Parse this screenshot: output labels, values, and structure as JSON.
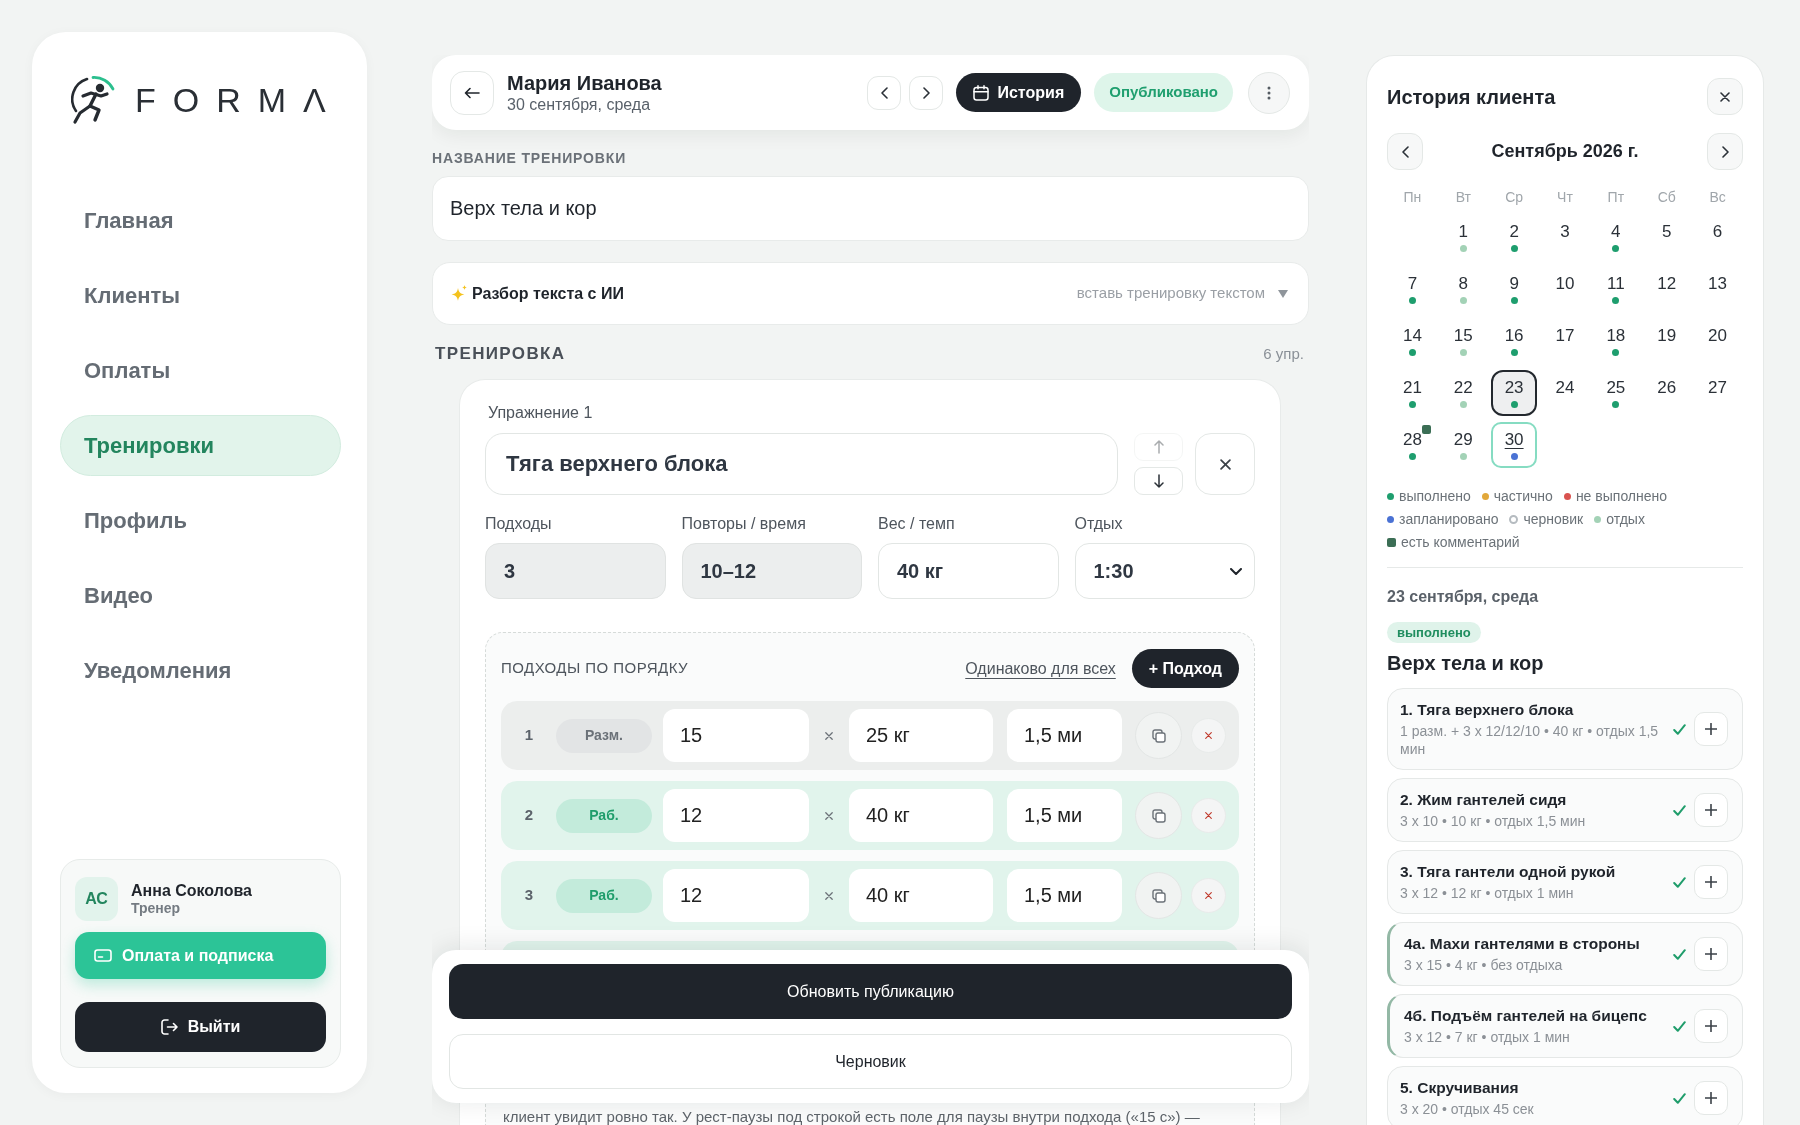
{
  "sidebar": {
    "logo": {
      "text": "FORMΛ"
    },
    "nav": [
      {
        "label": "Главная",
        "selected": false
      },
      {
        "label": "Клиенты",
        "selected": false
      },
      {
        "label": "Оплаты",
        "selected": false
      },
      {
        "label": "Тренировки",
        "selected": true
      },
      {
        "label": "Профиль",
        "selected": false
      },
      {
        "label": "Видео",
        "selected": false
      },
      {
        "label": "Уведомления",
        "selected": false
      }
    ],
    "user": {
      "initials": "АС",
      "name": "Анна Соколова",
      "role": "Тренер"
    },
    "buttons": [
      {
        "label": "Оплата и подписка",
        "kind": "payment"
      },
      {
        "label": "Выйти",
        "kind": "logout"
      }
    ]
  },
  "header": {
    "client_name": "Мария Иванова",
    "date": "30 сентября, среда",
    "history_button": "История",
    "status": "Опубликовано"
  },
  "workout_name": {
    "label": "НАЗВАНИЕ ТРЕНИРОВКИ",
    "value": "Верх тела и кор"
  },
  "ai_parser": {
    "title": "Разбор текста с ИИ",
    "hint": "вставь тренировку текстом",
    "expanded": false
  },
  "workout": {
    "title": "ТРЕНИРОВКА",
    "count": "6 упр.",
    "exercise": {
      "label": "Упражнение 1",
      "name": "Тяга верхнего блока",
      "move_buttons": [
        {
          "kind": "up",
          "disabled": true
        },
        {
          "kind": "down",
          "disabled": false
        }
      ],
      "fields": [
        {
          "label": "Подходы",
          "value": "3",
          "kind": "input",
          "disabled": true
        },
        {
          "label": "Повторы / время",
          "value": "10–12",
          "kind": "input",
          "disabled": true
        },
        {
          "label": "Вес / темп",
          "value": "40 кг",
          "kind": "input",
          "disabled": false
        },
        {
          "label": "Отдых",
          "value": "1:30",
          "kind": "select",
          "disabled": false
        }
      ],
      "sets": {
        "title": "ПОДХОДЫ ПО ПОРЯДКУ",
        "same_link": "Одинаково для всех",
        "add_button": "+ Подход",
        "rows": [
          {
            "number": "1",
            "type": "Разм.",
            "kind": "warmup",
            "reps": "15",
            "weight": "25 кг",
            "rest": "1,5 ми"
          },
          {
            "number": "2",
            "type": "Раб.",
            "kind": "work",
            "reps": "12",
            "weight": "40 кг",
            "rest": "1,5 ми"
          },
          {
            "number": "3",
            "type": "Раб.",
            "kind": "work",
            "reps": "12",
            "weight": "40 кг",
            "rest": "1,5 ми"
          }
        ],
        "note": "клиент увидит ровно так. У рест-паузы под строкой есть поле для паузы внутри подхода («15 с») —"
      }
    }
  },
  "actions": [
    {
      "label": "Обновить публикацию",
      "kind": "primary"
    },
    {
      "label": "Черновик",
      "kind": "secondary"
    }
  ],
  "history": {
    "title": "История клиента",
    "month": "Сентябрь 2026 г.",
    "weekdays": [
      "Пн",
      "Вт",
      "Ср",
      "Чт",
      "Пт",
      "Сб",
      "Вс"
    ],
    "weeks": [
      [
        {
          "day": "1",
          "color": "#a3d2b6",
          "selected": false,
          "today": false,
          "comment": false
        },
        {
          "day": "2",
          "color": "#1e9e6e",
          "selected": false,
          "today": false,
          "comment": false
        },
        {
          "day": "3",
          "selected": false,
          "today": false,
          "comment": false
        },
        {
          "day": "4",
          "color": "#1e9e6e",
          "selected": false,
          "today": false,
          "comment": false
        },
        {
          "day": "5",
          "selected": false,
          "today": false,
          "comment": false
        },
        {
          "day": "6",
          "selected": false,
          "today": false,
          "comment": false
        }
      ],
      [
        {
          "day": "7",
          "color": "#1e9e6e",
          "selected": false,
          "today": false,
          "comment": false
        },
        {
          "day": "8",
          "color": "#a3d2b6",
          "selected": false,
          "today": false,
          "comment": false
        },
        {
          "day": "9",
          "color": "#1e9e6e",
          "selected": false,
          "today": false,
          "comment": false
        },
        {
          "day": "10",
          "selected": false,
          "today": false,
          "comment": false
        },
        {
          "day": "11",
          "color": "#1e9e6e",
          "selected": false,
          "today": false,
          "comment": false
        },
        {
          "day": "12",
          "selected": false,
          "today": false,
          "comment": false
        },
        {
          "day": "13",
          "selected": false,
          "today": false,
          "comment": false
        }
      ],
      [
        {
          "day": "14",
          "color": "#1e9e6e",
          "selected": false,
          "today": false,
          "comment": false
        },
        {
          "day": "15",
          "color": "#a3d2b6",
          "selected": false,
          "today": false,
          "comment": false
        },
        {
          "day": "16",
          "color": "#1e9e6e",
          "selected": false,
          "today": false,
          "comment": false
        },
        {
          "day": "17",
          "selected": false,
          "today": false,
          "comment": false
        },
        {
          "day": "18",
          "color": "#1e9e6e",
          "selected": false,
          "today": false,
          "comment": false
        },
        {
          "day": "19",
          "selected": false,
          "today": false,
          "comment": false
        },
        {
          "day": "20",
          "selected": false,
          "today": false,
          "comment": false
        }
      ],
      [
        {
          "day": "21",
          "color": "#1e9e6e",
          "selected": false,
          "today": false,
          "comment": false
        },
        {
          "day": "22",
          "color": "#a3d2b6",
          "selected": false,
          "today": false,
          "comment": false
        },
        {
          "day": "23",
          "color": "#1e9e6e",
          "selected": true,
          "today": false,
          "comment": false
        },
        {
          "day": "24",
          "selected": false,
          "today": false,
          "comment": false
        },
        {
          "day": "25",
          "color": "#1e9e6e",
          "selected": false,
          "today": false,
          "comment": false
        },
        {
          "day": "26",
          "selected": false,
          "today": false,
          "comment": false
        },
        {
          "day": "27",
          "selected": false,
          "today": false,
          "comment": false
        }
      ],
      [
        {
          "day": "28",
          "color": "#1e9e6e",
          "selected": false,
          "today": false,
          "comment": true
        },
        {
          "day": "29",
          "color": "#a3d2b6",
          "selected": false,
          "today": false,
          "comment": false
        },
        {
          "day": "30",
          "color": "#4a72d4",
          "selected": false,
          "today": true,
          "comment": false
        }
      ]
    ],
    "legend": [
      {
        "label": "выполнено",
        "kind": "dot",
        "color": "#1e9e6e"
      },
      {
        "label": "частично",
        "kind": "dot",
        "color": "#e2a83a"
      },
      {
        "label": "не выполнено",
        "kind": "dot",
        "color": "#d9534f"
      },
      {
        "label": "запланировано",
        "kind": "dot",
        "color": "#4a72d4"
      },
      {
        "label": "черновик",
        "kind": "ring",
        "color": "#b5bbc0"
      },
      {
        "label": "отдых",
        "kind": "dot",
        "color": "#a3d2b6"
      },
      {
        "label": "есть комментарий",
        "kind": "square",
        "color": "#3b6e55"
      }
    ],
    "selected_day": {
      "date": "23 сентября, среда",
      "status": {
        "label": "выполнено",
        "kind": "done"
      },
      "title": "Верх тела и кор",
      "exercises": [
        {
          "title": "1. Тяга верхнего блока",
          "details": "1 разм. + 3 x 12/12/10 • 40 кг • отдых 1,5 мин",
          "done": true,
          "grouped": false
        },
        {
          "title": "2. Жим гантелей сидя",
          "details": "3 x 10 • 10 кг • отдых 1,5 мин",
          "done": true,
          "grouped": false
        },
        {
          "title": "3. Тяга гантели одной рукой",
          "details": "3 x 12 • 12 кг • отдых 1 мин",
          "done": true,
          "grouped": false
        },
        {
          "title": "4а. Махи гантелями в стороны",
          "details": "3 x 15 • 4 кг • без отдыха",
          "done": true,
          "grouped": true
        },
        {
          "title": "4б. Подъём гантелей на бицепс",
          "details": "3 x 12 • 7 кг • отдых 1 мин",
          "done": true,
          "grouped": true
        },
        {
          "title": "5. Скручивания",
          "details": "3 x 20 • отдых 45 сек",
          "done": true,
          "grouped": false
        }
      ]
    }
  }
}
